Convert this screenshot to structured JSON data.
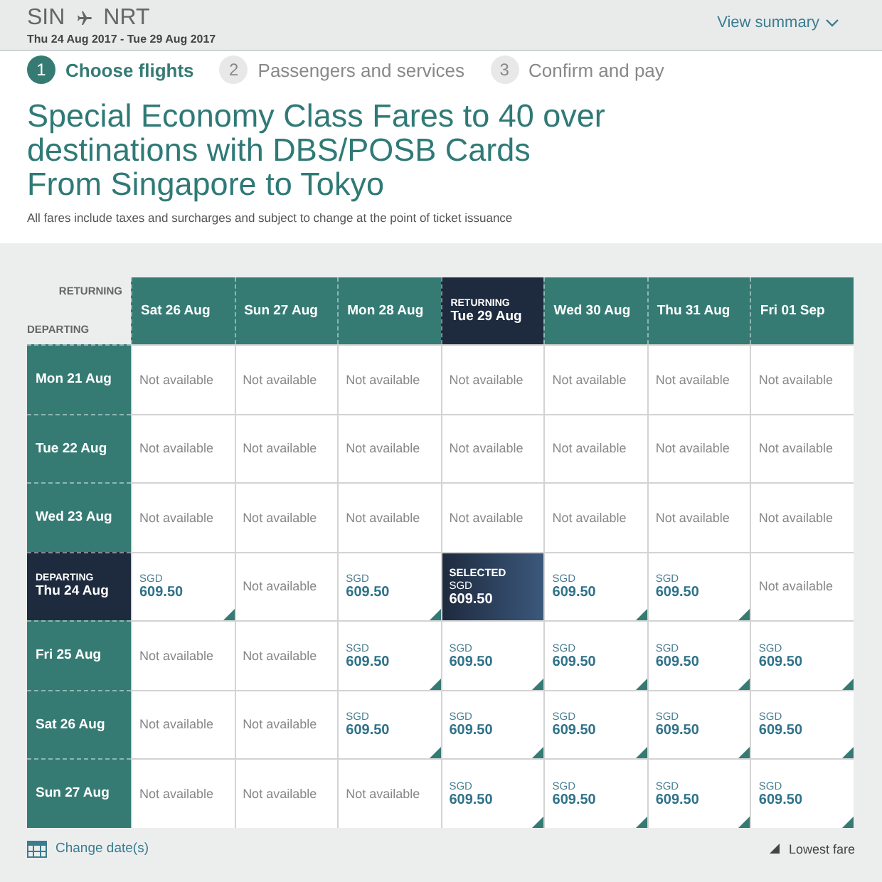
{
  "trip": {
    "origin": "SIN",
    "destination": "NRT",
    "dates": "Thu 24 Aug 2017 - Tue 29 Aug 2017",
    "summary_link": "View summary"
  },
  "steps": [
    {
      "number": "1",
      "label": "Choose flights",
      "selected": true
    },
    {
      "number": "2",
      "label": "Passengers and services",
      "selected": false
    },
    {
      "number": "3",
      "label": "Confirm and pay",
      "selected": false
    }
  ],
  "title_lines": [
    "Special Economy Class Fares to 40 over",
    "destinations with DBS/POSB Cards",
    "From Singapore to Tokyo"
  ],
  "disclaimer": "All fares include taxes and surcharges and subject to change at the point of ticket issuance",
  "grid": {
    "returning_label": "RETURNING",
    "departing_label": "DEPARTING",
    "columns": [
      {
        "label": "Sat 26 Aug",
        "selected": false
      },
      {
        "label": "Sun 27 Aug",
        "selected": false
      },
      {
        "label": "Mon 28 Aug",
        "selected": false
      },
      {
        "label": "Tue 29 Aug",
        "selected": true,
        "tag": "RETURNING"
      },
      {
        "label": "Wed 30 Aug",
        "selected": false
      },
      {
        "label": "Thu 31 Aug",
        "selected": false
      },
      {
        "label": "Fri 01 Sep",
        "selected": false
      }
    ],
    "rows": [
      {
        "label": "Mon 21 Aug",
        "selected": false,
        "cells": [
          {
            "kind": "na",
            "text": "Not available"
          },
          {
            "kind": "na",
            "text": "Not available"
          },
          {
            "kind": "na",
            "text": "Not available"
          },
          {
            "kind": "na",
            "text": "Not available"
          },
          {
            "kind": "na",
            "text": "Not available"
          },
          {
            "kind": "na",
            "text": "Not available"
          },
          {
            "kind": "na",
            "text": "Not available"
          }
        ]
      },
      {
        "label": "Tue 22 Aug",
        "selected": false,
        "cells": [
          {
            "kind": "na",
            "text": "Not available"
          },
          {
            "kind": "na",
            "text": "Not available"
          },
          {
            "kind": "na",
            "text": "Not available"
          },
          {
            "kind": "na",
            "text": "Not available"
          },
          {
            "kind": "na",
            "text": "Not available"
          },
          {
            "kind": "na",
            "text": "Not available"
          },
          {
            "kind": "na",
            "text": "Not available"
          }
        ]
      },
      {
        "label": "Wed 23 Aug",
        "selected": false,
        "cells": [
          {
            "kind": "na",
            "text": "Not available"
          },
          {
            "kind": "na",
            "text": "Not available"
          },
          {
            "kind": "na",
            "text": "Not available"
          },
          {
            "kind": "na",
            "text": "Not available"
          },
          {
            "kind": "na",
            "text": "Not available"
          },
          {
            "kind": "na",
            "text": "Not available"
          },
          {
            "kind": "na",
            "text": "Not available"
          }
        ]
      },
      {
        "label": "Thu 24 Aug",
        "selected": true,
        "tag": "DEPARTING",
        "cells": [
          {
            "kind": "fare",
            "currency": "SGD",
            "price": "609.50",
            "lowest": true,
            "selected": false
          },
          {
            "kind": "na",
            "text": "Not available"
          },
          {
            "kind": "fare",
            "currency": "SGD",
            "price": "609.50",
            "lowest": true,
            "selected": false
          },
          {
            "kind": "fare",
            "badge": "SELECTED",
            "currency": "SGD",
            "price": "609.50",
            "lowest": false,
            "selected": true
          },
          {
            "kind": "fare",
            "currency": "SGD",
            "price": "609.50",
            "lowest": true,
            "selected": false
          },
          {
            "kind": "fare",
            "currency": "SGD",
            "price": "609.50",
            "lowest": true,
            "selected": false
          },
          {
            "kind": "na",
            "text": "Not available"
          }
        ]
      },
      {
        "label": "Fri 25 Aug",
        "selected": false,
        "cells": [
          {
            "kind": "na",
            "text": "Not available"
          },
          {
            "kind": "na",
            "text": "Not available"
          },
          {
            "kind": "fare",
            "currency": "SGD",
            "price": "609.50",
            "lowest": true,
            "selected": false
          },
          {
            "kind": "fare",
            "currency": "SGD",
            "price": "609.50",
            "lowest": true,
            "selected": false
          },
          {
            "kind": "fare",
            "currency": "SGD",
            "price": "609.50",
            "lowest": true,
            "selected": false
          },
          {
            "kind": "fare",
            "currency": "SGD",
            "price": "609.50",
            "lowest": true,
            "selected": false
          },
          {
            "kind": "fare",
            "currency": "SGD",
            "price": "609.50",
            "lowest": true,
            "selected": false
          }
        ]
      },
      {
        "label": "Sat 26 Aug",
        "selected": false,
        "cells": [
          {
            "kind": "na",
            "text": "Not available"
          },
          {
            "kind": "na",
            "text": "Not available"
          },
          {
            "kind": "fare",
            "currency": "SGD",
            "price": "609.50",
            "lowest": true,
            "selected": false
          },
          {
            "kind": "fare",
            "currency": "SGD",
            "price": "609.50",
            "lowest": true,
            "selected": false
          },
          {
            "kind": "fare",
            "currency": "SGD",
            "price": "609.50",
            "lowest": true,
            "selected": false
          },
          {
            "kind": "fare",
            "currency": "SGD",
            "price": "609.50",
            "lowest": true,
            "selected": false
          },
          {
            "kind": "fare",
            "currency": "SGD",
            "price": "609.50",
            "lowest": true,
            "selected": false
          }
        ]
      },
      {
        "label": "Sun 27 Aug",
        "selected": false,
        "cells": [
          {
            "kind": "na",
            "text": "Not available"
          },
          {
            "kind": "na",
            "text": "Not available"
          },
          {
            "kind": "na",
            "text": "Not available"
          },
          {
            "kind": "fare",
            "currency": "SGD",
            "price": "609.50",
            "lowest": true,
            "selected": false
          },
          {
            "kind": "fare",
            "currency": "SGD",
            "price": "609.50",
            "lowest": true,
            "selected": false
          },
          {
            "kind": "fare",
            "currency": "SGD",
            "price": "609.50",
            "lowest": true,
            "selected": false
          },
          {
            "kind": "fare",
            "currency": "SGD",
            "price": "609.50",
            "lowest": true,
            "selected": false
          }
        ]
      }
    ]
  },
  "footer": {
    "change_link": "Change date(s)",
    "legend": "Lowest fare"
  }
}
